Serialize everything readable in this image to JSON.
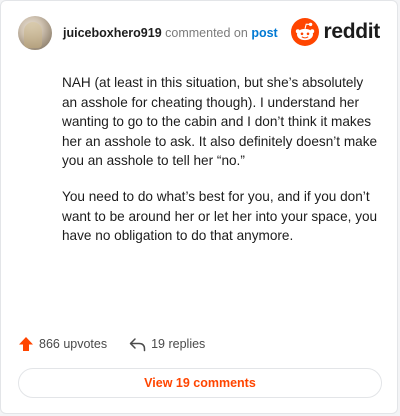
{
  "comment": {
    "username": "juiceboxhero919",
    "action": "commented on",
    "post_link": "post",
    "paragraphs": [
      "NAH (at least in this situation, but she’s absolutely an asshole for cheating though). I understand her wanting to go to the cabin and I don’t think it makes her an asshole to ask. It also definitely doesn’t make you an asshole to tell her “no.”",
      "You need to do what’s best for you, and if you don’t want to be around her or let her into your space, you have no obligation to do that anymore."
    ]
  },
  "brand": {
    "name": "reddit",
    "accent_color": "#ff4500"
  },
  "stats": {
    "upvotes": "866 upvotes",
    "replies": "19 replies"
  },
  "view_button": {
    "label": "View 19 comments"
  },
  "icons": {
    "avatar": "user-avatar",
    "logo": "reddit-snoo-icon",
    "upvote": "upvote-arrow-icon",
    "reply": "reply-arrow-icon"
  }
}
